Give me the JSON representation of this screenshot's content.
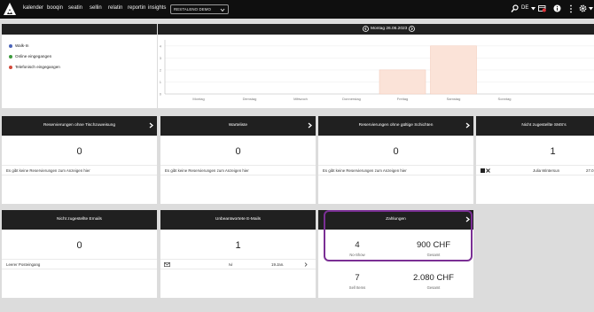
{
  "nav": {
    "items": [
      "kalender",
      "booqin",
      "seatin",
      "sellin",
      "relatin",
      "reportin",
      "insights"
    ],
    "restaurant": "RESTALENO DEMO",
    "language": "DE"
  },
  "colors": {
    "bar_topbar": "#0f0f0f",
    "highlight": "#7a2f94",
    "walkin": "#4a63b8",
    "online": "#3c9a3c",
    "phone": "#d24a3a",
    "bar_fill": "#fbe3d8"
  },
  "legend": {
    "items": [
      {
        "label": "Walk-In",
        "color": "#4a63b8"
      },
      {
        "label": "Online eingegangen",
        "color": "#3c9a3c"
      },
      {
        "label": "Telefonisch eingegangen",
        "color": "#d24a3a"
      }
    ]
  },
  "chart": {
    "date_label": "Montag 26.06.2023"
  },
  "chart_data": {
    "type": "bar",
    "categories": [
      "Montag",
      "Dienstag",
      "Mittwoch",
      "Donnerstag",
      "Freitag",
      "Samstag",
      "Sonntag"
    ],
    "values": [
      0,
      0,
      0,
      0,
      2,
      4,
      0
    ],
    "yticks": [
      "0",
      "1",
      "2",
      "3",
      "4"
    ],
    "ylim": [
      0,
      4.5
    ]
  },
  "cards": {
    "no_table": {
      "title": "Reservierungen ohne Tischzuweisung",
      "count": "0",
      "empty": "Es gibt keine Reservierungen zum Anzeigen hier"
    },
    "waitlist": {
      "title": "Warteliste",
      "count": "0",
      "empty": "Es gibt keine Reservierungen zum Anzeigen hier"
    },
    "no_shift": {
      "title": "Reservierungen ohne gültige Schichten",
      "count": "0",
      "empty": "Es gibt keine Reservierungen zum Anzeigen hier"
    },
    "sms": {
      "title": "Nicht zugestellte SMS's",
      "count": "1",
      "name": "Julia Wintersun",
      "date": "27.0"
    },
    "emails": {
      "title": "Nicht zugestellte Emails",
      "count": "0",
      "empty": "Leerer Posteingang"
    },
    "unanswered": {
      "title": "Unbeantwortete E-Mails",
      "count": "1",
      "sender": "Ivi",
      "date": "19.Jan."
    },
    "payments": {
      "title": "Zahlungen",
      "noshow_value": "4",
      "noshow_label": "No-Show",
      "total_value": "900 CHF",
      "total_label": "Gesamt",
      "sell_value": "7",
      "sell_label": "Sell Items",
      "sell_total_value": "2.080 CHF",
      "sell_total_label": "Gesamt"
    }
  }
}
